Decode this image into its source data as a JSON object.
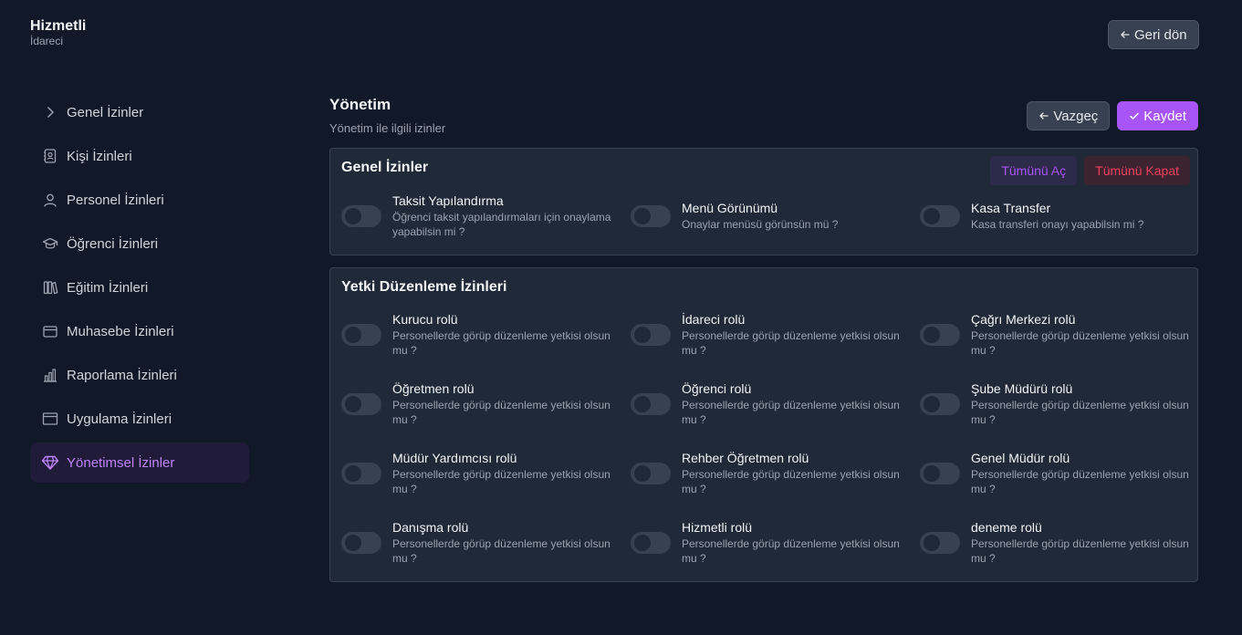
{
  "brand": {
    "title": "Hizmetli",
    "subtitle": "İdareci"
  },
  "header": {
    "back_label": "Geri dön"
  },
  "sidebar": {
    "items": [
      {
        "label": "Genel İzinler",
        "icon": "chevron-right-icon",
        "active": false
      },
      {
        "label": "Kişi İzinleri",
        "icon": "contact-book-icon",
        "active": false
      },
      {
        "label": "Personel İzinleri",
        "icon": "user-icon",
        "active": false
      },
      {
        "label": "Öğrenci İzinleri",
        "icon": "graduation-cap-icon",
        "active": false
      },
      {
        "label": "Eğitim İzinleri",
        "icon": "books-icon",
        "active": false
      },
      {
        "label": "Muhasebe İzinleri",
        "icon": "wallet-icon",
        "active": false
      },
      {
        "label": "Raporlama İzinleri",
        "icon": "bar-chart-icon",
        "active": false
      },
      {
        "label": "Uygulama İzinleri",
        "icon": "app-window-icon",
        "active": false
      },
      {
        "label": "Yönetimsel İzinler",
        "icon": "diamond-icon",
        "active": true
      }
    ]
  },
  "main": {
    "title": "Yönetim",
    "subtitle": "Yönetim ile ilgili izinler",
    "cancel_label": "Vazgeç",
    "save_label": "Kaydet",
    "general": {
      "title": "Genel İzinler",
      "open_all": "Tümünü Aç",
      "close_all": "Tümünü Kapat",
      "items": [
        {
          "title": "Taksit Yapılandırma",
          "desc": "Öğrenci taksit yapılandırmaları için onaylama yapabilsin mi ?",
          "enabled": false
        },
        {
          "title": "Menü Görünümü",
          "desc": "Onaylar menüsü görünsün mü ?",
          "enabled": false
        },
        {
          "title": "Kasa Transfer",
          "desc": "Kasa transferi onayı yapabilsin mi ?",
          "enabled": false
        }
      ]
    },
    "roles": {
      "title": "Yetki Düzenleme İzinleri",
      "items": [
        {
          "title": "Kurucu rolü",
          "desc": "Personellerde görüp düzenleme yetkisi olsun mu ?",
          "enabled": false
        },
        {
          "title": "İdareci rolü",
          "desc": "Personellerde görüp düzenleme yetkisi olsun mu ?",
          "enabled": false
        },
        {
          "title": "Çağrı Merkezi rolü",
          "desc": "Personellerde görüp düzenleme yetkisi olsun mu ?",
          "enabled": false
        },
        {
          "title": "Öğretmen rolü",
          "desc": "Personellerde görüp düzenleme yetkisi olsun mu ?",
          "enabled": false
        },
        {
          "title": "Öğrenci rolü",
          "desc": "Personellerde görüp düzenleme yetkisi olsun mu ?",
          "enabled": false
        },
        {
          "title": "Şube Müdürü rolü",
          "desc": "Personellerde görüp düzenleme yetkisi olsun mu ?",
          "enabled": false
        },
        {
          "title": "Müdür Yardımcısı rolü",
          "desc": "Personellerde görüp düzenleme yetkisi olsun mu ?",
          "enabled": false
        },
        {
          "title": "Rehber Öğretmen rolü",
          "desc": "Personellerde görüp düzenleme yetkisi olsun mu ?",
          "enabled": false
        },
        {
          "title": "Genel Müdür rolü",
          "desc": "Personellerde görüp düzenleme yetkisi olsun mu ?",
          "enabled": false
        },
        {
          "title": "Danışma rolü",
          "desc": "Personellerde görüp düzenleme yetkisi olsun mu ?",
          "enabled": false
        },
        {
          "title": "Hizmetli rolü",
          "desc": "Personellerde görüp düzenleme yetkisi olsun mu ?",
          "enabled": false
        },
        {
          "title": "deneme rolü",
          "desc": "Personellerde görüp düzenleme yetkisi olsun mu ?",
          "enabled": false
        }
      ]
    }
  },
  "colors": {
    "background": "#111827",
    "card": "#1f2937",
    "accent": "#a855f7",
    "danger": "#f43f5e"
  }
}
